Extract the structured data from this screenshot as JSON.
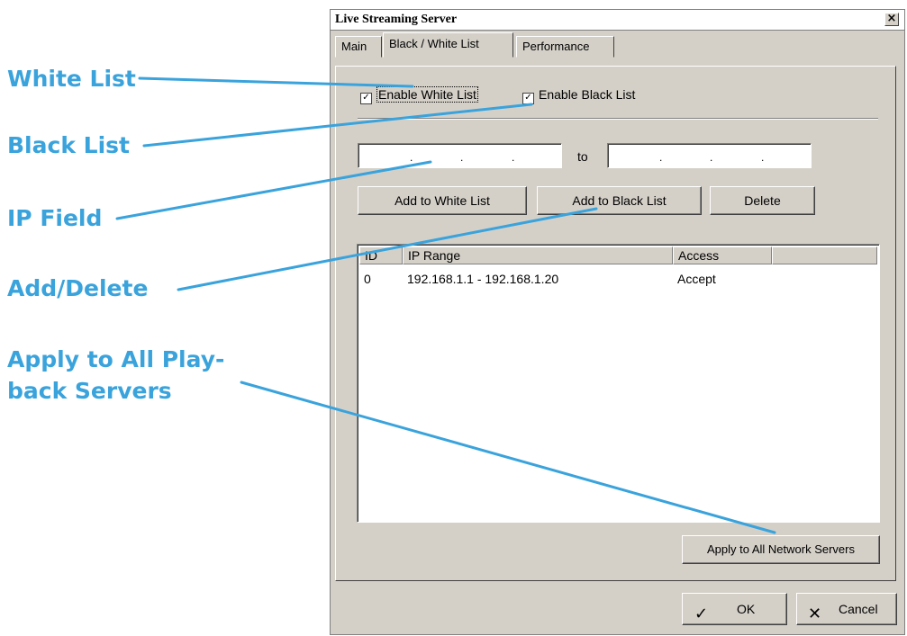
{
  "callouts": {
    "white_list": "White List",
    "black_list": "Black List",
    "ip_field": "IP Field",
    "add_delete": "Add/Delete",
    "apply_line1": "Apply to All Play-",
    "apply_line2": "back Servers"
  },
  "dialog": {
    "title": "Live Streaming Server",
    "close_glyph": "×",
    "tabs": [
      "Main",
      "Black / White List",
      "Performance"
    ],
    "active_tab": "Black / White List",
    "enable_white_list": {
      "label": "Enable White List",
      "checked": true
    },
    "enable_black_list": {
      "label": "Enable Black List",
      "checked": true
    },
    "check_glyph": "✓",
    "ip_from": {
      "dots": [
        ".",
        ".",
        "."
      ]
    },
    "to_label": "to",
    "ip_to": {
      "dots": [
        ".",
        ".",
        "."
      ]
    },
    "add_white_label": "Add to White List",
    "add_black_label": "Add to Black List",
    "delete_label": "Delete",
    "list": {
      "columns": [
        "ID",
        "IP Range",
        "Access"
      ],
      "rows": [
        {
          "id": "0",
          "range": "192.168.1.1 - 192.168.1.20",
          "access": "Accept"
        }
      ]
    },
    "apply_label": "Apply to All Network Servers",
    "ok_label": "OK",
    "cancel_label": "Cancel",
    "ok_icon": "✓",
    "cancel_icon": "✕"
  },
  "colors": {
    "callout": "#3aa3dc",
    "dialog_bg": "#d4d0c8"
  }
}
